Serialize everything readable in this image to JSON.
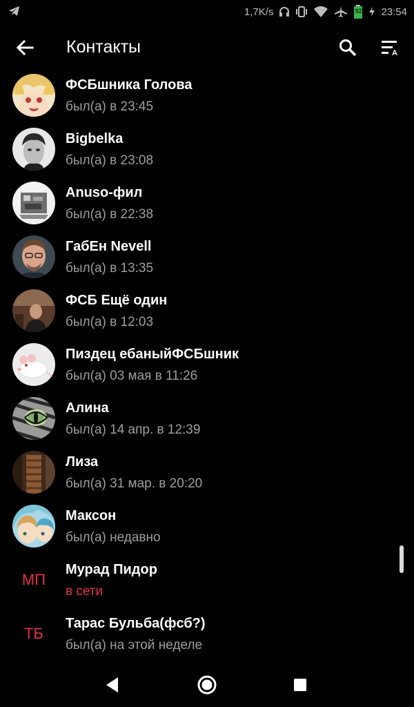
{
  "status_bar": {
    "speed": "1,7K/s",
    "battery": "92",
    "time": "23:54",
    "icons": [
      "telegram-icon",
      "headphones-icon",
      "vibrate-icon",
      "wifi-icon",
      "airplane-icon",
      "battery-icon",
      "charging-icon"
    ]
  },
  "app_bar": {
    "title": "Контакты",
    "icons": [
      "back-arrow-icon",
      "search-icon",
      "sort-icon"
    ]
  },
  "contacts": [
    {
      "name": "ФСБшника Голова",
      "status": "был(а) в 23:45",
      "online": false,
      "avatar": "anime-girl-avatar"
    },
    {
      "name": "Bigbelka",
      "status": "был(а) в 23:08",
      "online": false,
      "avatar": "bw-face-avatar"
    },
    {
      "name": "Anuso-фил",
      "status": "был(а) в 22:38",
      "online": false,
      "avatar": "sketch-avatar"
    },
    {
      "name": "ГабЕн Nevell",
      "status": "был(а) в 13:35",
      "online": false,
      "avatar": "man-photo-avatar"
    },
    {
      "name": "ФСБ Ещё один",
      "status": "был(а) в 12:03",
      "online": false,
      "avatar": "dark-photo-avatar"
    },
    {
      "name": "Пиздец ебаныйФСБшник",
      "status": "был(а) 03 мая в 11:26",
      "online": false,
      "avatar": "white-rat-avatar"
    },
    {
      "name": "Алина",
      "status": "был(а) 14 апр. в 12:39",
      "online": false,
      "avatar": "cat-eye-avatar"
    },
    {
      "name": "Лиза",
      "status": "был(а) 31 мар. в 20:20",
      "online": false,
      "avatar": "brown-photo-avatar"
    },
    {
      "name": "Максон",
      "status": "был(а) недавно",
      "online": false,
      "avatar": "anime-boy-avatar"
    },
    {
      "name": "Мурад Пидор",
      "status": "в сети",
      "online": true,
      "initials": "МП"
    },
    {
      "name": "Тарас Бульба(фсб?)",
      "status": "был(а) на этой неделе",
      "online": false,
      "initials": "ТБ"
    }
  ],
  "colors": {
    "background": "#000000",
    "text_primary": "#ffffff",
    "text_secondary": "#9e9e9e",
    "accent": "#e5314b"
  },
  "nav_bar": {
    "icons": [
      "nav-back-icon",
      "nav-home-icon",
      "nav-recent-icon"
    ]
  }
}
